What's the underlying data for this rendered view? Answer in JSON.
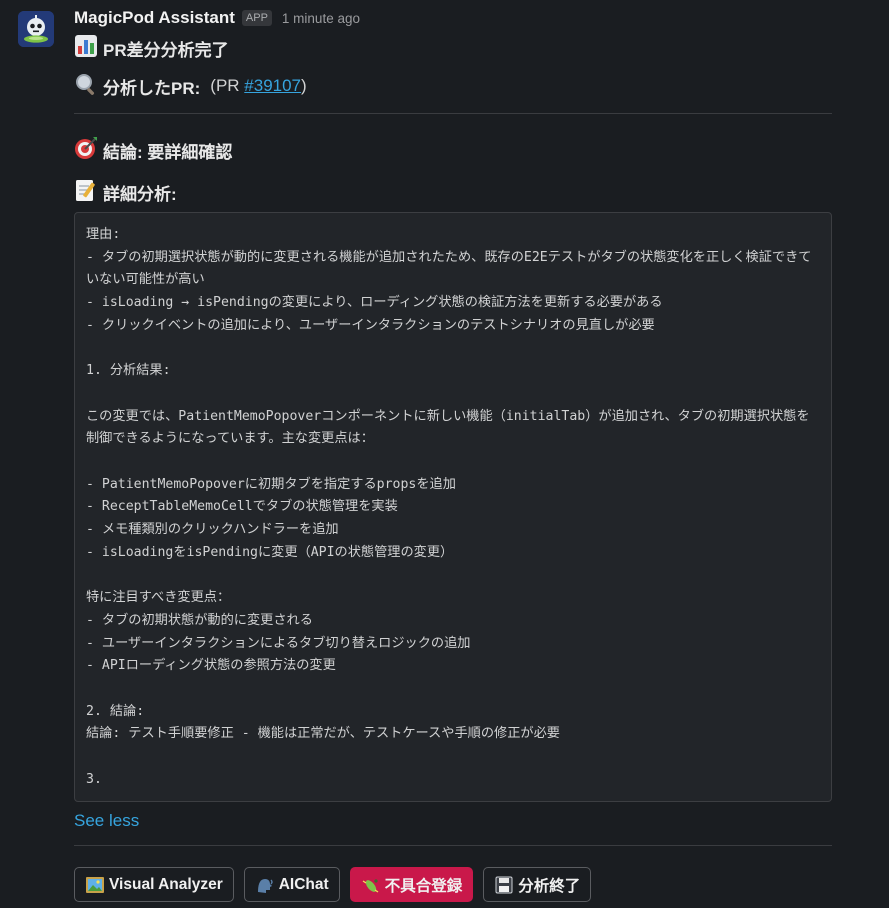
{
  "message": {
    "sender": "MagicPod Assistant",
    "badge": "APP",
    "timestamp": "1 minute ago",
    "title": "PR差分分析完了",
    "pr_label": "分析したPR:",
    "pr_prefix": "(PR ",
    "pr_number": "#39107",
    "pr_suffix": ")",
    "result_label": "結論: 要詳細確認",
    "detail_label": "詳細分析:",
    "detail_text": "理由:\n- タブの初期選択状態が動的に変更される機能が追加されたため、既存のE2Eテストがタブの状態変化を正しく検証できていない可能性が高い\n- isLoading → isPendingの変更により、ローディング状態の検証方法を更新する必要がある\n- クリックイベントの追加により、ユーザーインタラクションのテストシナリオの見直しが必要\n\n1. 分析結果:\n\nこの変更では、PatientMemoPopoverコンポーネントに新しい機能（initialTab）が追加され、タブの初期選択状態を制御できるようになっています。主な変更点は：\n\n- PatientMemoPopoverに初期タブを指定するpropsを追加\n- ReceptTableMemoCellでタブの状態管理を実装\n- メモ種類別のクリックハンドラーを追加\n- isLoadingをisPendingに変更（APIの状態管理の変更）\n\n特に注目すべき変更点：\n- タブの初期状態が動的に変更される\n- ユーザーインタラクションによるタブ切り替えロジックの追加\n- APIローディング状態の参照方法の変更\n\n2. 結論:\n結論: テスト手順要修正 - 機能は正常だが、テストケースや手順の修正が必要\n\n3.",
    "see_less": "See less"
  },
  "buttons": [
    {
      "label": "Visual Analyzer",
      "icon": "frame-picture-icon"
    },
    {
      "label": "AIChat",
      "icon": "speaking-head-icon"
    },
    {
      "label": "不具合登録",
      "icon": "bug-icon",
      "style": "danger"
    },
    {
      "label": "分析終了",
      "icon": "floppy-disk-icon"
    }
  ],
  "colors": {
    "background": "#1a1d21",
    "link": "#36a4de",
    "danger_button": "#c9184a",
    "code_background": "#222529"
  }
}
